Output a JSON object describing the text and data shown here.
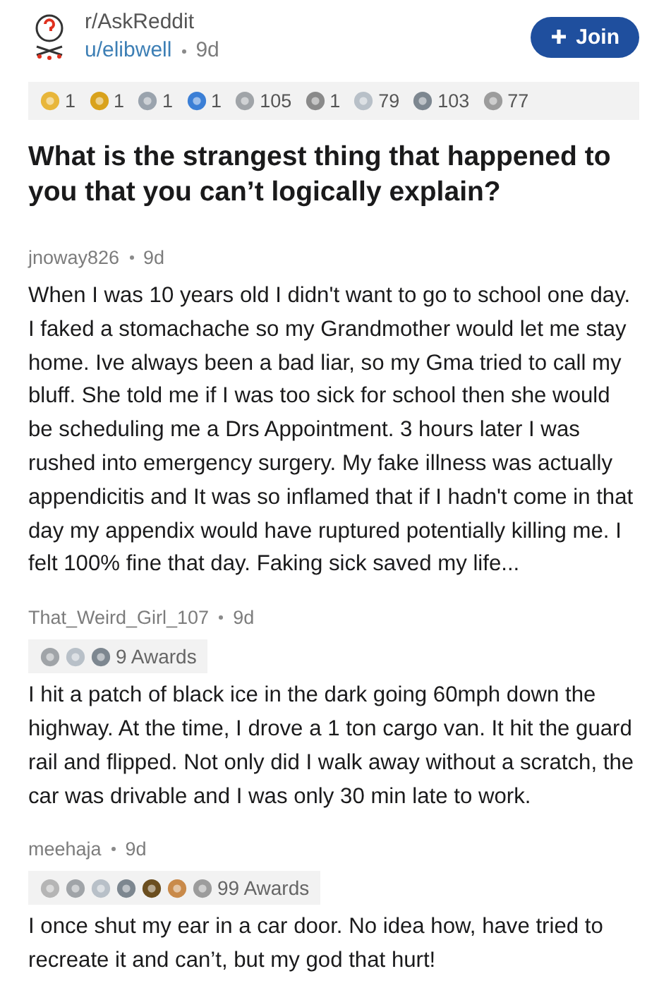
{
  "post": {
    "subreddit": "r/AskReddit",
    "user": "u/elibwell",
    "time": "9d",
    "join_label": "Join",
    "title": "What is the strangest thing that happened to you that you can’t logically explain?",
    "awards": [
      {
        "color": "#e8b63a",
        "count": "1"
      },
      {
        "color": "#d9a21c",
        "count": "1"
      },
      {
        "color": "#9aa3ad",
        "count": "1"
      },
      {
        "color": "#3b7fd6",
        "count": "1"
      },
      {
        "color": "#a0a4a8",
        "count": "105"
      },
      {
        "color": "#8a8a8a",
        "count": "1"
      },
      {
        "color": "#b8c0c8",
        "count": "79"
      },
      {
        "color": "#7d8790",
        "count": "103"
      },
      {
        "color": "#9c9c9c",
        "count": "77"
      }
    ]
  },
  "comments": [
    {
      "author": "jnoway826",
      "time": "9d",
      "body": "When I was 10 years old I didn't want to go to school one day. I faked a stomachache so my Grandmother would let me stay home. Ive always been a bad liar, so my Gma tried to call my bluff. She told me if I was too sick for school then she would be scheduling me a Drs Appointment. 3 hours later I was rushed into emergency surgery. My fake illness was actually appendicitis and It was so inflamed that if I hadn't come in that day my appendix would have ruptured potentially killing me. I felt 100% fine that day. Faking sick saved my life..."
    },
    {
      "author": "That_Weird_Girl_107",
      "time": "9d",
      "award_icons": [
        {
          "color": "#a0a4a8"
        },
        {
          "color": "#b8c0c8"
        },
        {
          "color": "#7d8790"
        }
      ],
      "award_count": "9 Awards",
      "body": "I hit a patch of black ice in the dark going 60mph down the highway. At the time, I drove a 1 ton cargo van. It hit the guard rail and flipped. Not only did I walk away without a scratch, the car was drivable and I was only 30 min late to work."
    },
    {
      "author": "meehaja",
      "time": "9d",
      "award_icons": [
        {
          "color": "#b5b5b5"
        },
        {
          "color": "#a0a4a8"
        },
        {
          "color": "#b8c0c8"
        },
        {
          "color": "#7d8790"
        },
        {
          "color": "#6b4e1f"
        },
        {
          "color": "#c98a4a"
        },
        {
          "color": "#9c9c9c"
        }
      ],
      "award_count": "99 Awards",
      "body": "I once shut my ear in a car door. No idea how, have tried to recreate it and can’t, but my god that hurt!"
    }
  ]
}
